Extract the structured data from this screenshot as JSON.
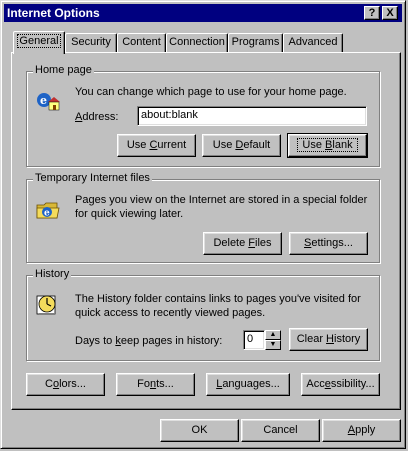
{
  "window": {
    "title": "Internet Options",
    "help_button": "?",
    "close_button": "X"
  },
  "tabs": [
    {
      "label": "General",
      "active": true
    },
    {
      "label": "Security"
    },
    {
      "label": "Content"
    },
    {
      "label": "Connection"
    },
    {
      "label": "Programs"
    },
    {
      "label": "Advanced"
    }
  ],
  "home_page": {
    "legend": "Home page",
    "description": "You can change which page to use for your home page.",
    "address_label": "Address:",
    "address_value": "about:blank",
    "use_current": "Use Current",
    "use_default": "Use Default",
    "use_blank": "Use Blank",
    "icon": "home-page-icon"
  },
  "temp_files": {
    "legend": "Temporary Internet files",
    "description_line1": "Pages you view on the Internet are stored in a special folder",
    "description_line2": "for quick viewing later.",
    "delete_files": "Delete Files",
    "settings": "Settings...",
    "icon": "folder-icon"
  },
  "history": {
    "legend": "History",
    "description_line1": "The History folder contains links to pages you've visited for",
    "description_line2": "quick access to recently viewed pages.",
    "days_label": "Days to keep pages in history:",
    "days_value": "0",
    "clear_history": "Clear History",
    "icon": "history-icon"
  },
  "bottom_row": {
    "colors": "Colors...",
    "fonts": "Fonts...",
    "languages": "Languages...",
    "accessibility": "Accessibility..."
  },
  "dialog_buttons": {
    "ok": "OK",
    "cancel": "Cancel",
    "apply": "Apply"
  }
}
